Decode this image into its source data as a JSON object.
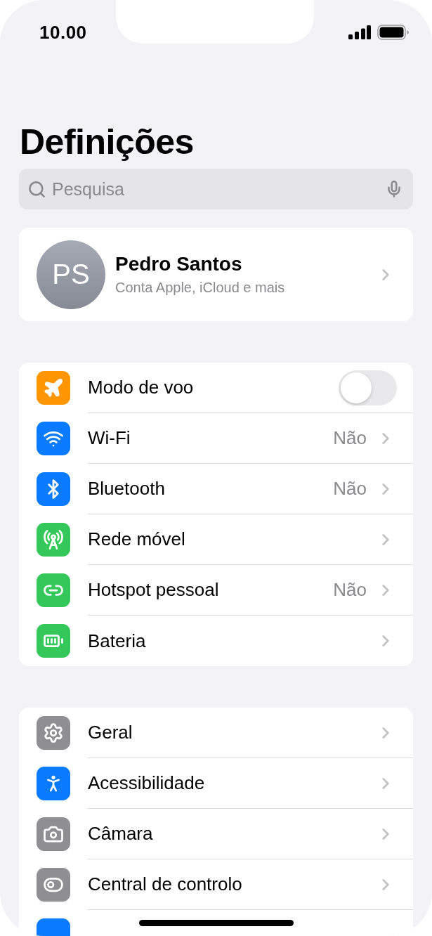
{
  "status_bar": {
    "time": "10.00"
  },
  "title": "Definições",
  "search": {
    "placeholder": "Pesquisa"
  },
  "profile": {
    "initials": "PS",
    "name": "Pedro Santos",
    "subtitle": "Conta Apple, iCloud e mais"
  },
  "sections": [
    {
      "items": [
        {
          "kind": "toggle",
          "color": "#ff9500",
          "label": "Modo de voo",
          "on": false
        },
        {
          "kind": "link",
          "color": "#0a7aff",
          "label": "Wi-Fi",
          "value": "Não"
        },
        {
          "kind": "link",
          "color": "#0a7aff",
          "label": "Bluetooth",
          "value": "Não"
        },
        {
          "kind": "link",
          "color": "#34c759",
          "label": "Rede móvel"
        },
        {
          "kind": "link",
          "color": "#34c759",
          "label": "Hotspot pessoal",
          "value": "Não"
        },
        {
          "kind": "link",
          "color": "#34c759",
          "label": "Bateria"
        }
      ]
    },
    {
      "items": [
        {
          "kind": "link",
          "color": "#8e8e93",
          "label": "Geral"
        },
        {
          "kind": "link",
          "color": "#0a7aff",
          "label": "Acessibilidade"
        },
        {
          "kind": "link",
          "color": "#8e8e93",
          "label": "Câmara"
        },
        {
          "kind": "link",
          "color": "#8e8e93",
          "label": "Central de controlo"
        },
        {
          "kind": "partial",
          "color": "#0a7aff"
        }
      ]
    }
  ]
}
